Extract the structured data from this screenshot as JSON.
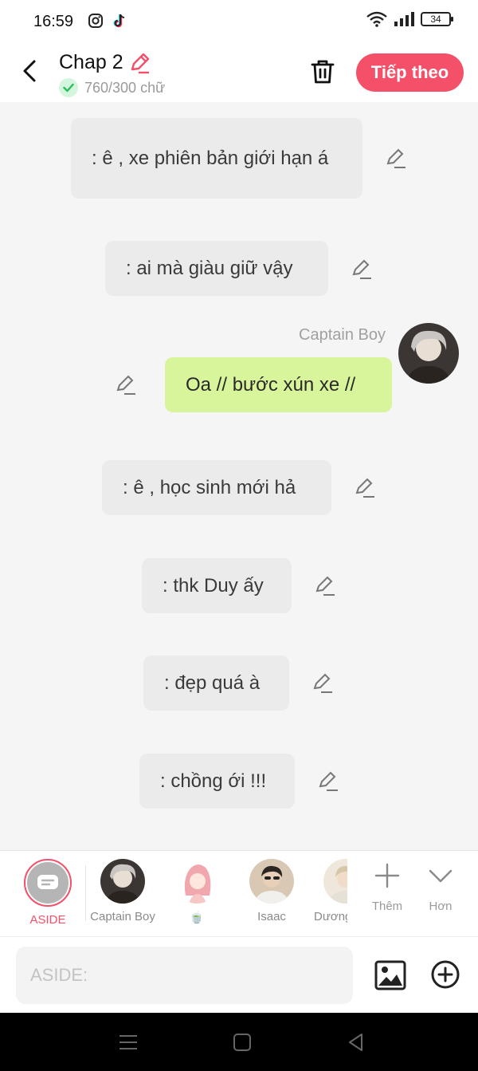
{
  "status_bar": {
    "time": "16:59",
    "battery": "34",
    "icons": [
      "instagram-icon",
      "tiktok-icon",
      "wifi-icon",
      "signal-icon",
      "battery-icon"
    ]
  },
  "header": {
    "title": "Chap 2",
    "word_count": "760/300 chữ",
    "next_label": "Tiếp theo",
    "icons": [
      "back-arrow-icon",
      "pencil-icon",
      "check-icon",
      "trash-icon"
    ]
  },
  "messages": [
    {
      "text": ": ê , xe phiên bản giới hạn á",
      "type": "aside"
    },
    {
      "text": ": ai mà giàu giữ vậy",
      "type": "aside"
    },
    {
      "text": "Oa // bước xún xe //",
      "type": "character",
      "sender": "Captain Boy"
    },
    {
      "text": ": ê , học sinh mới hả",
      "type": "aside"
    },
    {
      "text": ": thk Duy ấy",
      "type": "aside"
    },
    {
      "text": ": đẹp quá à",
      "type": "aside"
    },
    {
      "text": ": chồng ới !!!",
      "type": "aside"
    }
  ],
  "characters": {
    "aside_label": "ASIDE",
    "items": [
      "Captain Boy",
      "🍵",
      "Isaac",
      "Dương"
    ],
    "more_label": "Thêm",
    "expand_label": "Hơn"
  },
  "input": {
    "placeholder": "ASIDE:"
  },
  "colors": {
    "accent": "#f4506a",
    "character_bubble": "#d9f59b",
    "aside_bubble": "#ebebeb",
    "background": "#f5f5f5"
  }
}
